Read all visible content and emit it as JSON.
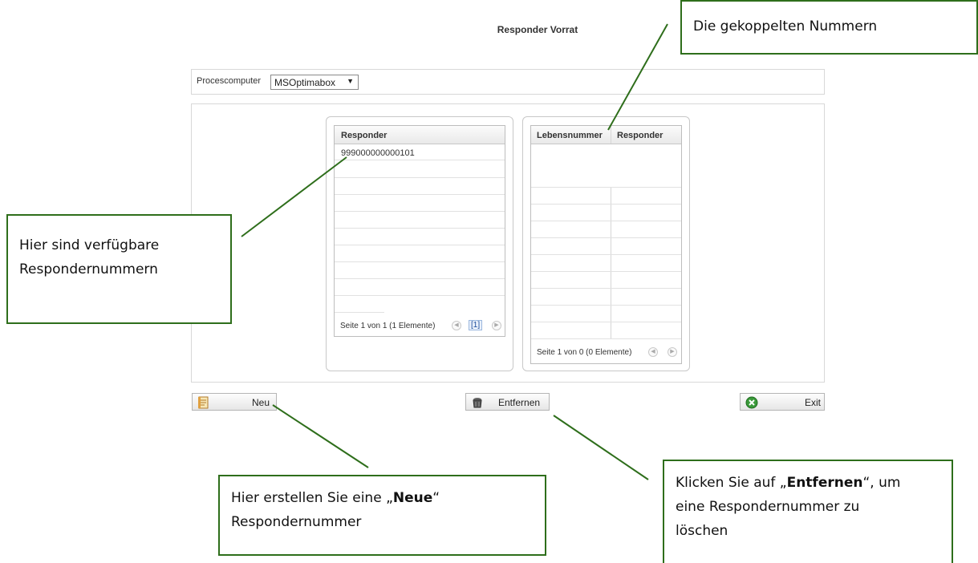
{
  "title": "Responder Vorrat",
  "process_computer": {
    "label": "Procescomputer",
    "selected": "MSOptimabox"
  },
  "left_grid": {
    "header": "Responder",
    "rows": [
      "999000000000101"
    ],
    "pager_text": "Seite 1 von 1 (1 Elemente)",
    "page_link": "[1]"
  },
  "right_grid": {
    "headers": [
      "Lebensnummer",
      "Responder"
    ],
    "rows": [],
    "pager_text": "Seite 1 von 0 (0 Elemente)"
  },
  "buttons": {
    "new": "Neu",
    "remove": "Entfernen",
    "exit": "Exit"
  },
  "callouts": {
    "top": "Die gekoppelten Nummern",
    "left_line1": "Hier sind verfügbare",
    "left_line2": "Respondernummern",
    "new_pre": "Hier erstellen Sie eine „",
    "new_bold": "Neue",
    "new_post": "“",
    "new_line2": "Respondernummer",
    "remove_pre": "Klicken Sie auf „",
    "remove_bold": "Entfernen",
    "remove_post": "“, um",
    "remove_line2": "eine Respondernummer zu",
    "remove_line3": "löschen"
  },
  "colors": {
    "callout_border": "#2e6e1b",
    "leader_line": "#2e6e1b"
  }
}
